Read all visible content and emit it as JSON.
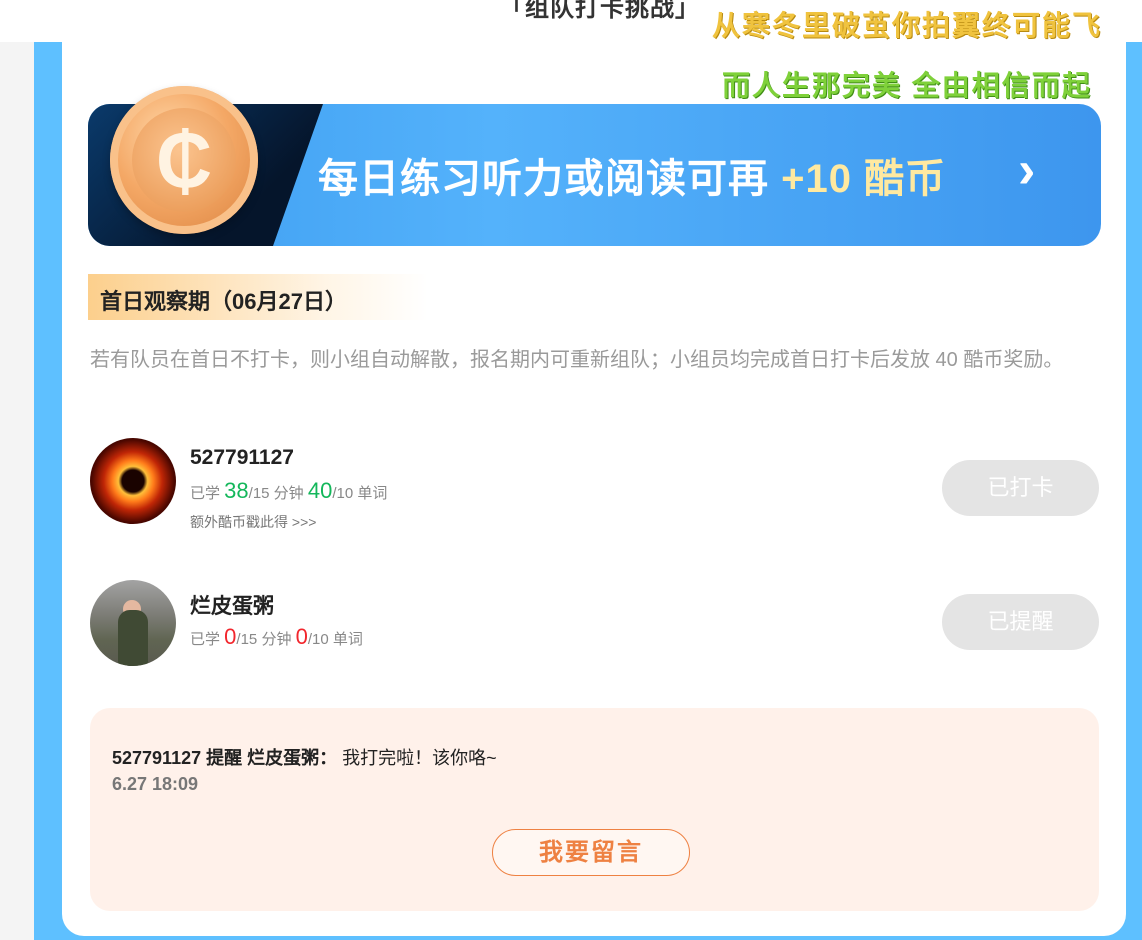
{
  "header": {
    "team_title": "「组队打卡挑战」",
    "lyric_line1": "从寒冬里破茧你拍翼终可能飞",
    "lyric_line2": "而人生那完美 全由相信而起"
  },
  "banner": {
    "text_main": "每日练习听力或阅读可再 ",
    "text_highlight": "+10 酷币",
    "arrow": "›",
    "coin_symbol": "₵"
  },
  "section": {
    "title": "首日观察期（06月27日）",
    "description": "若有队员在首日不打卡，则小组自动解散，报名期内可重新组队；小组员均完成首日打卡后发放 40 酷币奖励。"
  },
  "members": [
    {
      "name": "527791127",
      "studied_prefix": "已学 ",
      "minutes": "38",
      "minutes_suffix": "/15 分钟  ",
      "words": "40",
      "words_suffix": "/10 单词",
      "extra": "额外酷币戳此得 >>>",
      "status": "已打卡"
    },
    {
      "name": "烂皮蛋粥",
      "studied_prefix": "已学 ",
      "minutes": "0",
      "minutes_suffix": "/15 分钟  ",
      "words": "0",
      "words_suffix": "/10 单词",
      "status": "已提醒"
    }
  ],
  "message": {
    "sender": "527791127",
    "action": " 提醒 ",
    "target": "烂皮蛋粥：",
    "content": " 我打完啦！该你咯~",
    "time": "6.27 18:09",
    "button": "我要留言"
  },
  "colors": {
    "frame_blue": "#5ec0ff",
    "accent_green": "#14b75b",
    "accent_red": "#f2262d",
    "accent_orange": "#ee8142"
  }
}
